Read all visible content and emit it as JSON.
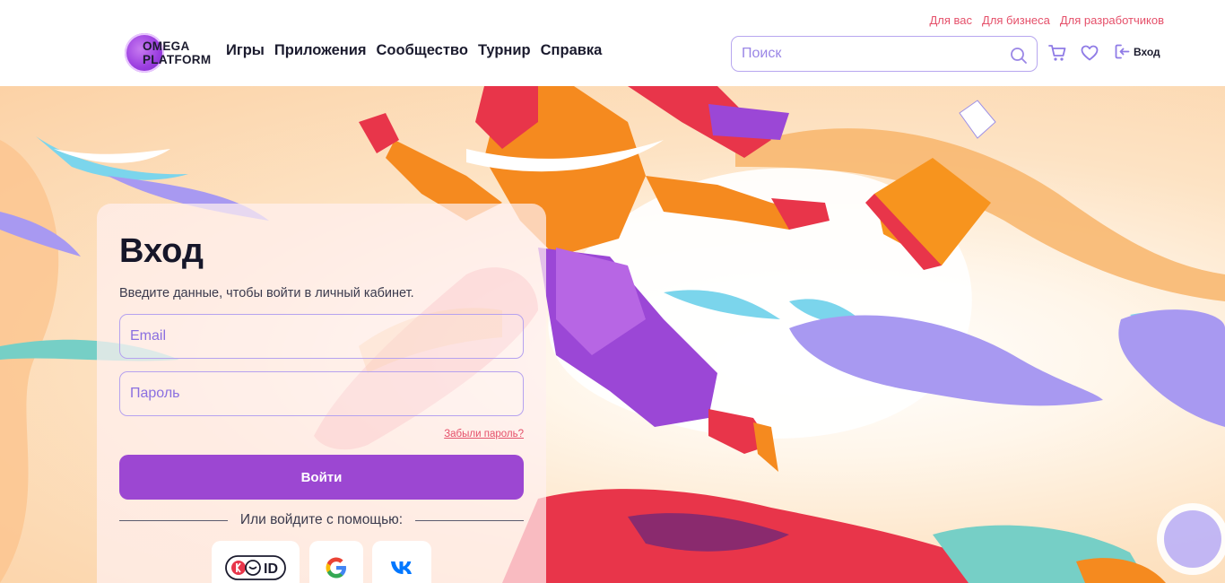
{
  "header": {
    "top_links": [
      "Для вас",
      "Для бизнеса",
      "Для разработчиков"
    ],
    "logo": {
      "line1": "OMEGA",
      "line2": "PLATFORM"
    },
    "nav": [
      "Игры",
      "Приложения",
      "Сообщество",
      "Турнир",
      "Справка"
    ],
    "search": {
      "placeholder": "Поиск",
      "value": ""
    },
    "icons": [
      "cart-icon",
      "heart-icon",
      "login-icon"
    ],
    "login_label": "Вход"
  },
  "login_card": {
    "title": "Вход",
    "subtitle": "Введите данные, чтобы войти в личный кабинет.",
    "email_placeholder": "Email",
    "password_placeholder": "Пароль",
    "forgot_label": "Забыли пароль?",
    "submit_label": "Войти",
    "divider_label": "Или войдите с помощью:",
    "social": [
      {
        "name": "yandex-id",
        "label": "ID"
      },
      {
        "name": "google",
        "label": "G"
      },
      {
        "name": "vk",
        "label": "VK"
      }
    ]
  },
  "colors": {
    "accent": "#9c47d2",
    "link": "#e5506a",
    "border": "#b6a2ef",
    "text": "#1b1b2e"
  }
}
